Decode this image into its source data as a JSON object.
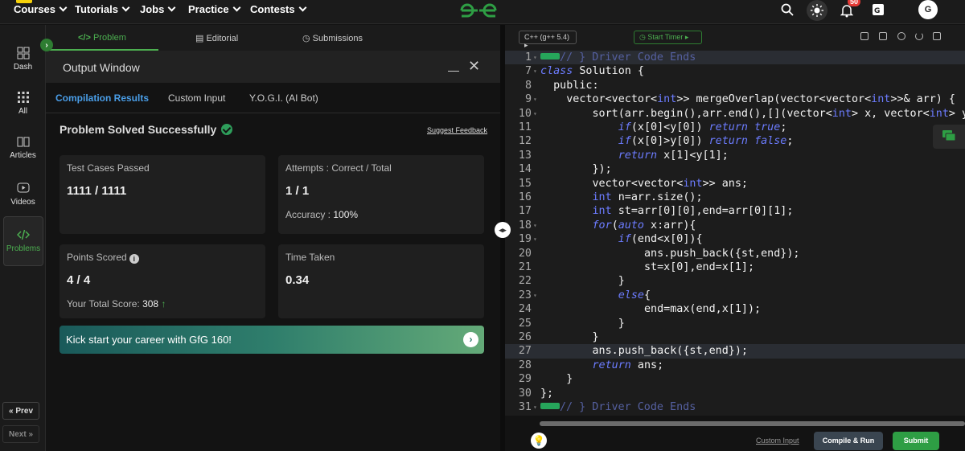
{
  "nav": {
    "items": [
      {
        "label": "Courses",
        "name": "nav-courses"
      },
      {
        "label": "Tutorials",
        "name": "nav-tutorials"
      },
      {
        "label": "Jobs",
        "name": "nav-jobs"
      },
      {
        "label": "Practice",
        "name": "nav-practice"
      },
      {
        "label": "Contests",
        "name": "nav-contests"
      }
    ],
    "notification_count": "50",
    "avatar_initial": "G",
    "colors": {
      "logo": "#2e9e44",
      "accent": "#4caf50"
    }
  },
  "sidebar": {
    "items": [
      {
        "label": "Dash",
        "icon": "grid-icon"
      },
      {
        "label": "All",
        "icon": "dots-grid-icon"
      },
      {
        "label": "Articles",
        "icon": "book-icon"
      },
      {
        "label": "Videos",
        "icon": "play-icon"
      },
      {
        "label": "Problems",
        "icon": "code-icon"
      }
    ],
    "prev_label": "« Prev",
    "next_label": "Next »"
  },
  "tabs": {
    "problem": "Problem",
    "editorial": "Editorial",
    "submissions": "Submissions"
  },
  "output": {
    "title": "Output Window",
    "subtabs": [
      "Compilation Results",
      "Custom Input",
      "Y.O.G.I. (AI Bot)"
    ],
    "status": "Problem Solved Successfully",
    "suggest_feedback": "Suggest Feedback",
    "test_cases_label": "Test Cases Passed",
    "test_cases_value": "1111 / 1111",
    "attempts_label": "Attempts : Correct / Total",
    "attempts_value": "1 / 1",
    "accuracy_label": "Accuracy :",
    "accuracy_value": "100%",
    "points_label": "Points Scored",
    "points_value": "4 / 4",
    "total_score_label": "Your Total Score:",
    "total_score_value": "308",
    "time_label": "Time Taken",
    "time_value": "0.34",
    "promo": "Kick start your career with GfG 160!"
  },
  "editor": {
    "language": "C++ (g++ 5.4)",
    "timer": "Start Timer",
    "custom_input": "Custom Input",
    "compile_run": "Compile & Run",
    "submit": "Submit",
    "lines": [
      {
        "n": "1",
        "fold": true,
        "pill": true,
        "text": "// } Driver Code Ends",
        "comment": true,
        "hl": true
      },
      {
        "n": "7",
        "fold": true,
        "text": "class Solution {"
      },
      {
        "n": "8",
        "text": "  public:"
      },
      {
        "n": "9",
        "fold": true,
        "text": "    vector<vector<int>> mergeOverlap(vector<vector<int>>& arr) {"
      },
      {
        "n": "10",
        "fold": true,
        "text": "        sort(arr.begin(),arr.end(),[](vector<int> x, vector<int> y){"
      },
      {
        "n": "11",
        "text": "            if(x[0]<y[0]) return true;"
      },
      {
        "n": "12",
        "text": "            if(x[0]>y[0]) return false;"
      },
      {
        "n": "13",
        "text": "            return x[1]<y[1];"
      },
      {
        "n": "14",
        "text": "        });"
      },
      {
        "n": "15",
        "text": "        vector<vector<int>> ans;"
      },
      {
        "n": "16",
        "text": "        int n=arr.size();"
      },
      {
        "n": "17",
        "text": "        int st=arr[0][0],end=arr[0][1];"
      },
      {
        "n": "18",
        "fold": true,
        "text": "        for(auto x:arr){"
      },
      {
        "n": "19",
        "fold": true,
        "text": "            if(end<x[0]){"
      },
      {
        "n": "20",
        "text": "                ans.push_back({st,end});"
      },
      {
        "n": "21",
        "text": "                st=x[0],end=x[1];"
      },
      {
        "n": "22",
        "text": "            }"
      },
      {
        "n": "23",
        "fold": true,
        "text": "            else{"
      },
      {
        "n": "24",
        "text": "                end=max(end,x[1]);"
      },
      {
        "n": "25",
        "text": "            }"
      },
      {
        "n": "26",
        "text": "        }"
      },
      {
        "n": "27",
        "text": "        ans.push_back({st,end});",
        "hl": true
      },
      {
        "n": "28",
        "text": "        return ans;"
      },
      {
        "n": "29",
        "text": "    }"
      },
      {
        "n": "30",
        "text": "};"
      },
      {
        "n": "31",
        "fold": true,
        "pill": true,
        "text": "// } Driver Code Ends",
        "comment": true
      }
    ]
  }
}
